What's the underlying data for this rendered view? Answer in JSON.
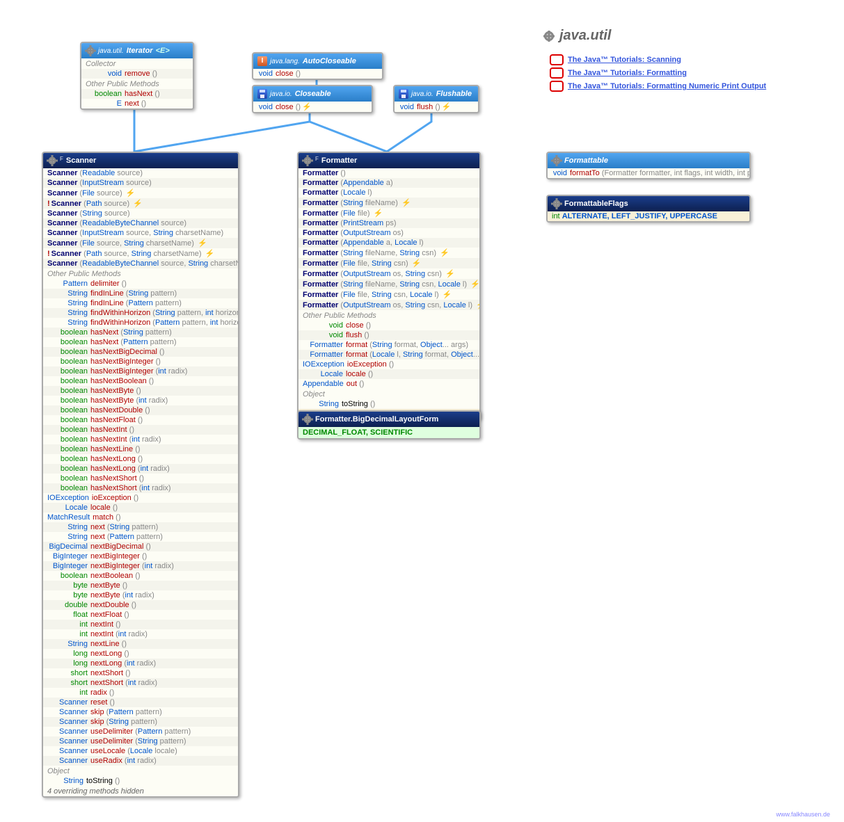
{
  "package": "java.util",
  "links": [
    "The Java™ Tutorials: Scanning",
    "The Java™ Tutorials: Formatting",
    "The Java™ Tutorials: Formatting Numeric Print Output"
  ],
  "iterator": {
    "title_pkg": "java.util.",
    "title": "Iterator",
    "title_suffix": "<E>",
    "sect1": "Collector",
    "r1_ret": "void",
    "r1_name": "remove",
    "r1_sig": "()",
    "sect2": "Other Public Methods",
    "r2_ret": "boolean",
    "r2_name": "hasNext",
    "r2_sig": "()",
    "r3_ret": "E",
    "r3_name": "next",
    "r3_sig": "()"
  },
  "autocloseable": {
    "title_pkg": "java.lang.",
    "title": "AutoCloseable",
    "r1_ret": "void",
    "r1_name": "close",
    "r1_sig": "()"
  },
  "closeable": {
    "title_pkg": "java.io.",
    "title": "Closeable",
    "r1_ret": "void",
    "r1_name": "close",
    "r1_sig": "()"
  },
  "flushable": {
    "title_pkg": "java.io.",
    "title": "Flushable",
    "r1_ret": "void",
    "r1_name": "flush",
    "r1_sig": "()"
  },
  "formattable": {
    "title": "Formattable",
    "r1_ret": "void",
    "r1_name": "formatTo",
    "r1_sig": "(Formatter formatter, int flags, int width, int precision)"
  },
  "formattableflags": {
    "title": "FormattableFlags",
    "r1_ret": "int",
    "r1_vals": "ALTERNATE, LEFT_JUSTIFY, UPPERCASE"
  },
  "bdlf": {
    "title": "Formatter.BigDecimalLayoutForm",
    "vals": "DECIMAL_FLOAT, SCIENTIFIC"
  },
  "formatter": {
    "sup": "F",
    "title": "Formatter",
    "ctors": [
      {
        "sig": "()"
      },
      {
        "sig": "(Appendable a)"
      },
      {
        "sig": "(Locale l)"
      },
      {
        "sig": "(String fileName)",
        "m": "7"
      },
      {
        "sig": "(File file)",
        "m": "7"
      },
      {
        "sig": "(PrintStream ps)"
      },
      {
        "sig": "(OutputStream os)"
      },
      {
        "sig": "(Appendable a, Locale l)"
      },
      {
        "sig": "(String fileName, String csn)",
        "m": "7"
      },
      {
        "sig": "(File file, String csn)",
        "m": "7"
      },
      {
        "sig": "(OutputStream os, String csn)",
        "m": "7"
      },
      {
        "sig": "(String fileName, String csn, Locale l)",
        "m": "7"
      },
      {
        "sig": "(File file, String csn, Locale l)",
        "m": "7"
      },
      {
        "sig": "(OutputStream os, String csn, Locale l)",
        "m": "7"
      }
    ],
    "sect": "Other Public Methods",
    "methods": [
      {
        "ret": "void",
        "name": "close",
        "sig": "()"
      },
      {
        "ret": "void",
        "name": "flush",
        "sig": "()"
      },
      {
        "ret": "Formatter",
        "name": "format",
        "sig": "(String format, Object... args)"
      },
      {
        "ret": "Formatter",
        "name": "format",
        "sig": "(Locale l, String format, Object... args)"
      },
      {
        "ret": "IOException",
        "name": "ioException",
        "sig": "()"
      },
      {
        "ret": "Locale",
        "name": "locale",
        "sig": "()"
      },
      {
        "ret": "Appendable",
        "name": "out",
        "sig": "()"
      }
    ],
    "sect_obj": "Object",
    "ts_ret": "String",
    "ts_name": "toString",
    "ts_sig": "()",
    "nav": "enum",
    "nav_name": "BigDecimalLayoutForm"
  },
  "scanner": {
    "sup": "F",
    "title": "Scanner",
    "ctors": [
      {
        "sig": "(Readable source)"
      },
      {
        "sig": "(InputStream source)"
      },
      {
        "sig": "(File source)",
        "m": "7"
      },
      {
        "sig": "(Path source)",
        "m": "7",
        "exc": "!"
      },
      {
        "sig": "(String source)"
      },
      {
        "sig": "(ReadableByteChannel source)"
      },
      {
        "sig": "(InputStream source, String charsetName)"
      },
      {
        "sig": "(File source, String charsetName)",
        "m": "7"
      },
      {
        "sig": "(Path source, String charsetName)",
        "m": "7",
        "exc": "!"
      },
      {
        "sig": "(ReadableByteChannel source, String charsetName)"
      }
    ],
    "sect": "Other Public Methods",
    "methods": [
      {
        "ret": "Pattern",
        "name": "delimiter",
        "sig": "()"
      },
      {
        "ret": "String",
        "name": "findInLine",
        "sig": "(String pattern)"
      },
      {
        "ret": "String",
        "name": "findInLine",
        "sig": "(Pattern pattern)"
      },
      {
        "ret": "String",
        "name": "findWithinHorizon",
        "sig": "(String pattern, int horizon)"
      },
      {
        "ret": "String",
        "name": "findWithinHorizon",
        "sig": "(Pattern pattern, int horizon)"
      },
      {
        "ret": "boolean",
        "name": "hasNext",
        "sig": "(String pattern)"
      },
      {
        "ret": "boolean",
        "name": "hasNext",
        "sig": "(Pattern pattern)"
      },
      {
        "ret": "boolean",
        "name": "hasNextBigDecimal",
        "sig": "()"
      },
      {
        "ret": "boolean",
        "name": "hasNextBigInteger",
        "sig": "()"
      },
      {
        "ret": "boolean",
        "name": "hasNextBigInteger",
        "sig": "(int radix)"
      },
      {
        "ret": "boolean",
        "name": "hasNextBoolean",
        "sig": "()"
      },
      {
        "ret": "boolean",
        "name": "hasNextByte",
        "sig": "()"
      },
      {
        "ret": "boolean",
        "name": "hasNextByte",
        "sig": "(int radix)"
      },
      {
        "ret": "boolean",
        "name": "hasNextDouble",
        "sig": "()"
      },
      {
        "ret": "boolean",
        "name": "hasNextFloat",
        "sig": "()"
      },
      {
        "ret": "boolean",
        "name": "hasNextInt",
        "sig": "()"
      },
      {
        "ret": "boolean",
        "name": "hasNextInt",
        "sig": "(int radix)"
      },
      {
        "ret": "boolean",
        "name": "hasNextLine",
        "sig": "()"
      },
      {
        "ret": "boolean",
        "name": "hasNextLong",
        "sig": "()"
      },
      {
        "ret": "boolean",
        "name": "hasNextLong",
        "sig": "(int radix)"
      },
      {
        "ret": "boolean",
        "name": "hasNextShort",
        "sig": "()"
      },
      {
        "ret": "boolean",
        "name": "hasNextShort",
        "sig": "(int radix)"
      },
      {
        "ret": "IOException",
        "name": "ioException",
        "sig": "()"
      },
      {
        "ret": "Locale",
        "name": "locale",
        "sig": "()"
      },
      {
        "ret": "MatchResult",
        "name": "match",
        "sig": "()"
      },
      {
        "ret": "String",
        "name": "next",
        "sig": "(String pattern)"
      },
      {
        "ret": "String",
        "name": "next",
        "sig": "(Pattern pattern)"
      },
      {
        "ret": "BigDecimal",
        "name": "nextBigDecimal",
        "sig": "()"
      },
      {
        "ret": "BigInteger",
        "name": "nextBigInteger",
        "sig": "()"
      },
      {
        "ret": "BigInteger",
        "name": "nextBigInteger",
        "sig": "(int radix)"
      },
      {
        "ret": "boolean",
        "name": "nextBoolean",
        "sig": "()"
      },
      {
        "ret": "byte",
        "name": "nextByte",
        "sig": "()"
      },
      {
        "ret": "byte",
        "name": "nextByte",
        "sig": "(int radix)"
      },
      {
        "ret": "double",
        "name": "nextDouble",
        "sig": "()"
      },
      {
        "ret": "float",
        "name": "nextFloat",
        "sig": "()"
      },
      {
        "ret": "int",
        "name": "nextInt",
        "sig": "()"
      },
      {
        "ret": "int",
        "name": "nextInt",
        "sig": "(int radix)"
      },
      {
        "ret": "String",
        "name": "nextLine",
        "sig": "()"
      },
      {
        "ret": "long",
        "name": "nextLong",
        "sig": "()"
      },
      {
        "ret": "long",
        "name": "nextLong",
        "sig": "(int radix)"
      },
      {
        "ret": "short",
        "name": "nextShort",
        "sig": "()"
      },
      {
        "ret": "short",
        "name": "nextShort",
        "sig": "(int radix)"
      },
      {
        "ret": "int",
        "name": "radix",
        "sig": "()"
      },
      {
        "ret": "Scanner",
        "name": "reset",
        "sig": "()"
      },
      {
        "ret": "Scanner",
        "name": "skip",
        "sig": "(Pattern pattern)"
      },
      {
        "ret": "Scanner",
        "name": "skip",
        "sig": "(String pattern)"
      },
      {
        "ret": "Scanner",
        "name": "useDelimiter",
        "sig": "(Pattern pattern)"
      },
      {
        "ret": "Scanner",
        "name": "useDelimiter",
        "sig": "(String pattern)"
      },
      {
        "ret": "Scanner",
        "name": "useLocale",
        "sig": "(Locale locale)"
      },
      {
        "ret": "Scanner",
        "name": "useRadix",
        "sig": "(int radix)"
      }
    ],
    "sect_obj": "Object",
    "ts_ret": "String",
    "ts_name": "toString",
    "ts_sig": "()",
    "foot": "4 overriding methods hidden"
  },
  "credit": "www.falkhausen.de"
}
